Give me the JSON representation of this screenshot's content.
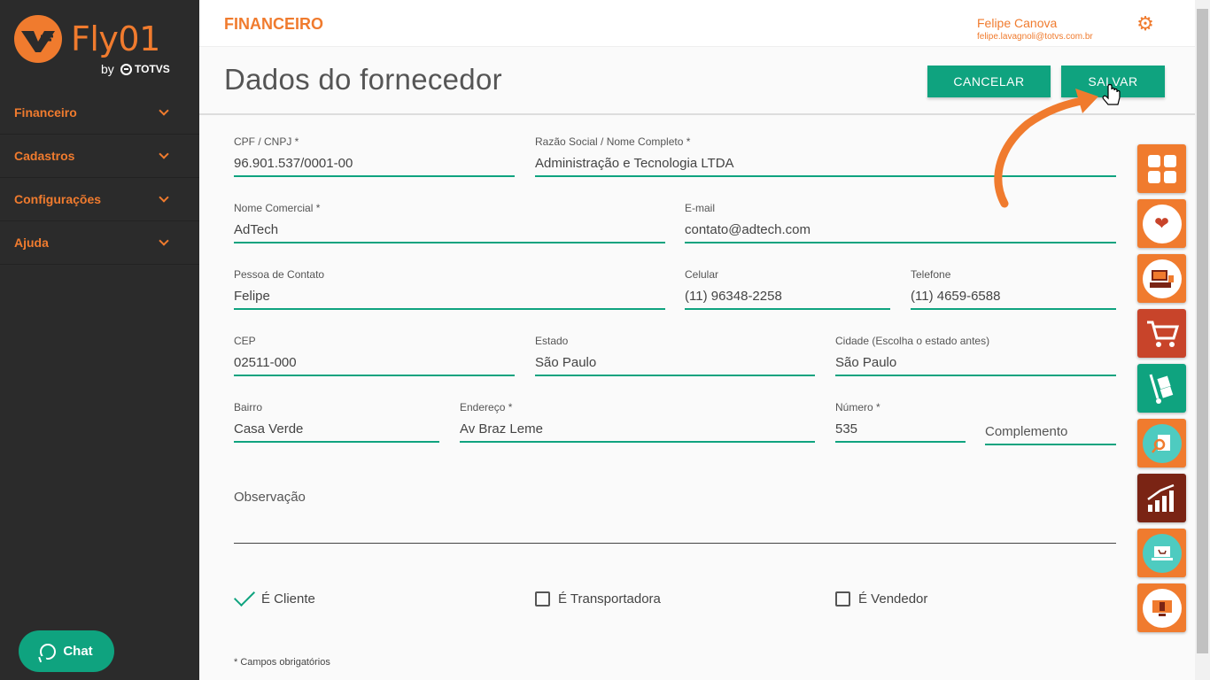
{
  "sidebar": {
    "logo": {
      "brand": "Fly01",
      "by": "by",
      "company": "TOTVS"
    },
    "items": [
      {
        "label": "Financeiro"
      },
      {
        "label": "Cadastros"
      },
      {
        "label": "Configurações"
      },
      {
        "label": "Ajuda"
      }
    ],
    "chat_label": "Chat"
  },
  "header": {
    "module": "FINANCEIRO",
    "user_name": "Felipe Canova",
    "user_email": "felipe.lavagnoli@totvs.com.br"
  },
  "page": {
    "title": "Dados do fornecedor",
    "cancel_label": "CANCELAR",
    "save_label": "SALVAR"
  },
  "form": {
    "cpf_cnpj": {
      "label": "CPF / CNPJ *",
      "value": "96.901.537/0001-00"
    },
    "razao_social": {
      "label": "Razão Social / Nome Completo *",
      "value": "Administração e Tecnologia LTDA"
    },
    "nome_comercial": {
      "label": "Nome Comercial *",
      "value": "AdTech"
    },
    "email": {
      "label": "E-mail",
      "value": "contato@adtech.com"
    },
    "pessoa_contato": {
      "label": "Pessoa de Contato",
      "value": "Felipe"
    },
    "celular": {
      "label": "Celular",
      "value": "(11) 96348-2258"
    },
    "telefone": {
      "label": "Telefone",
      "value": "(11) 4659-6588"
    },
    "cep": {
      "label": "CEP",
      "value": "02511-000"
    },
    "estado": {
      "label": "Estado",
      "value": "São Paulo"
    },
    "cidade": {
      "label": "Cidade (Escolha o estado antes)",
      "value": "São Paulo"
    },
    "bairro": {
      "label": "Bairro",
      "value": "Casa Verde"
    },
    "endereco": {
      "label": "Endereço *",
      "value": "Av Braz Leme"
    },
    "numero": {
      "label": "Número *",
      "value": "535"
    },
    "complemento": {
      "placeholder": "Complemento"
    },
    "observacao": {
      "placeholder": "Observação"
    },
    "checks": {
      "cliente": {
        "label": "É Cliente",
        "checked": true
      },
      "transportadora": {
        "label": "É Transportadora",
        "checked": false
      },
      "vendedor": {
        "label": "É Vendedor",
        "checked": false
      }
    },
    "required_note": "* Campos obrigatórios"
  },
  "apps": [
    {
      "icon": "dashboard-grid-icon",
      "color": "#f07b2e"
    },
    {
      "icon": "heart-health-icon",
      "color": "#f07b2e"
    },
    {
      "icon": "pos-terminal-icon",
      "color": "#f07b2e"
    },
    {
      "icon": "shopping-cart-icon",
      "color": "#c8442a"
    },
    {
      "icon": "hand-truck-icon",
      "color": "#0fa37f"
    },
    {
      "icon": "report-search-icon",
      "color": "#f07b2e"
    },
    {
      "icon": "growth-chart-icon",
      "color": "#7a2414"
    },
    {
      "icon": "laptop-cart-icon",
      "color": "#f07b2e"
    },
    {
      "icon": "invoice-screen-icon",
      "color": "#f07b2e"
    }
  ],
  "colors": {
    "accent": "#f07b2e",
    "primary": "#0fa37f",
    "sidebar": "#2b2b2b"
  }
}
